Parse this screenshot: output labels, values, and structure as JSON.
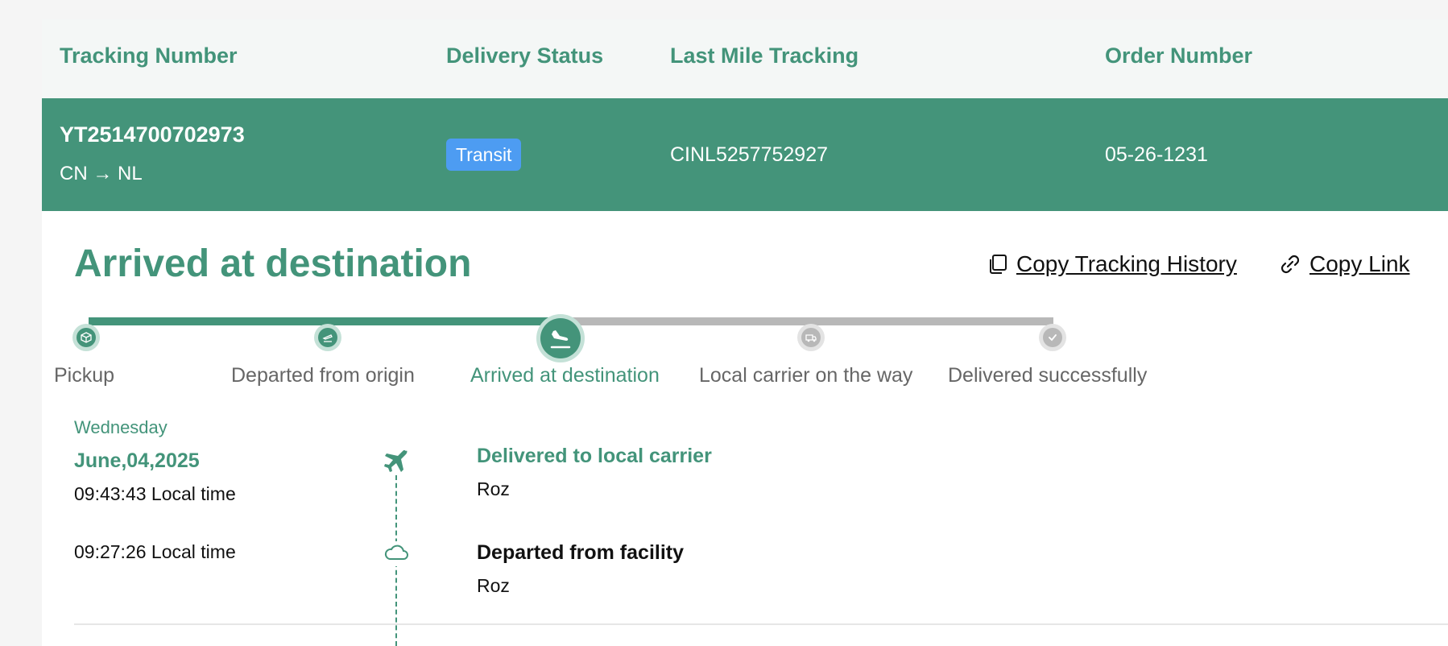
{
  "table": {
    "headers": {
      "tracking_number": "Tracking Number",
      "delivery_status": "Delivery Status",
      "last_mile": "Last Mile Tracking",
      "order_number": "Order Number"
    },
    "row": {
      "tracking_number": "YT2514700702973",
      "route": "CN → NL",
      "status": "Transit",
      "last_mile": "CINL5257752927",
      "order_number": "05-26-1231"
    }
  },
  "status_title": "Arrived at destination",
  "actions": {
    "copy_history": "Copy Tracking History",
    "copy_link": "Copy Link"
  },
  "steps": [
    {
      "label": "Pickup",
      "state": "done",
      "icon": "package-icon"
    },
    {
      "label": "Departed from origin",
      "state": "done",
      "icon": "plane-departure-icon"
    },
    {
      "label": "Arrived at destination",
      "state": "current",
      "icon": "plane-arrival-icon"
    },
    {
      "label": "Local carrier on the way",
      "state": "pending",
      "icon": "truck-icon"
    },
    {
      "label": "Delivered successfully",
      "state": "pending",
      "icon": "check-icon"
    }
  ],
  "timeline": {
    "day_name": "Wednesday",
    "date": "June,04,2025",
    "events": [
      {
        "time": "09:43:43 Local time",
        "title": "Delivered to local carrier",
        "location": "Roz",
        "icon": "airplane-icon"
      },
      {
        "time": "09:27:26 Local time",
        "title": "Departed from facility",
        "location": "Roz",
        "icon": "cloud-icon"
      }
    ]
  },
  "colors": {
    "brand": "#44947a",
    "badge": "#4d9cf2",
    "pending": "#b8b8b8"
  }
}
